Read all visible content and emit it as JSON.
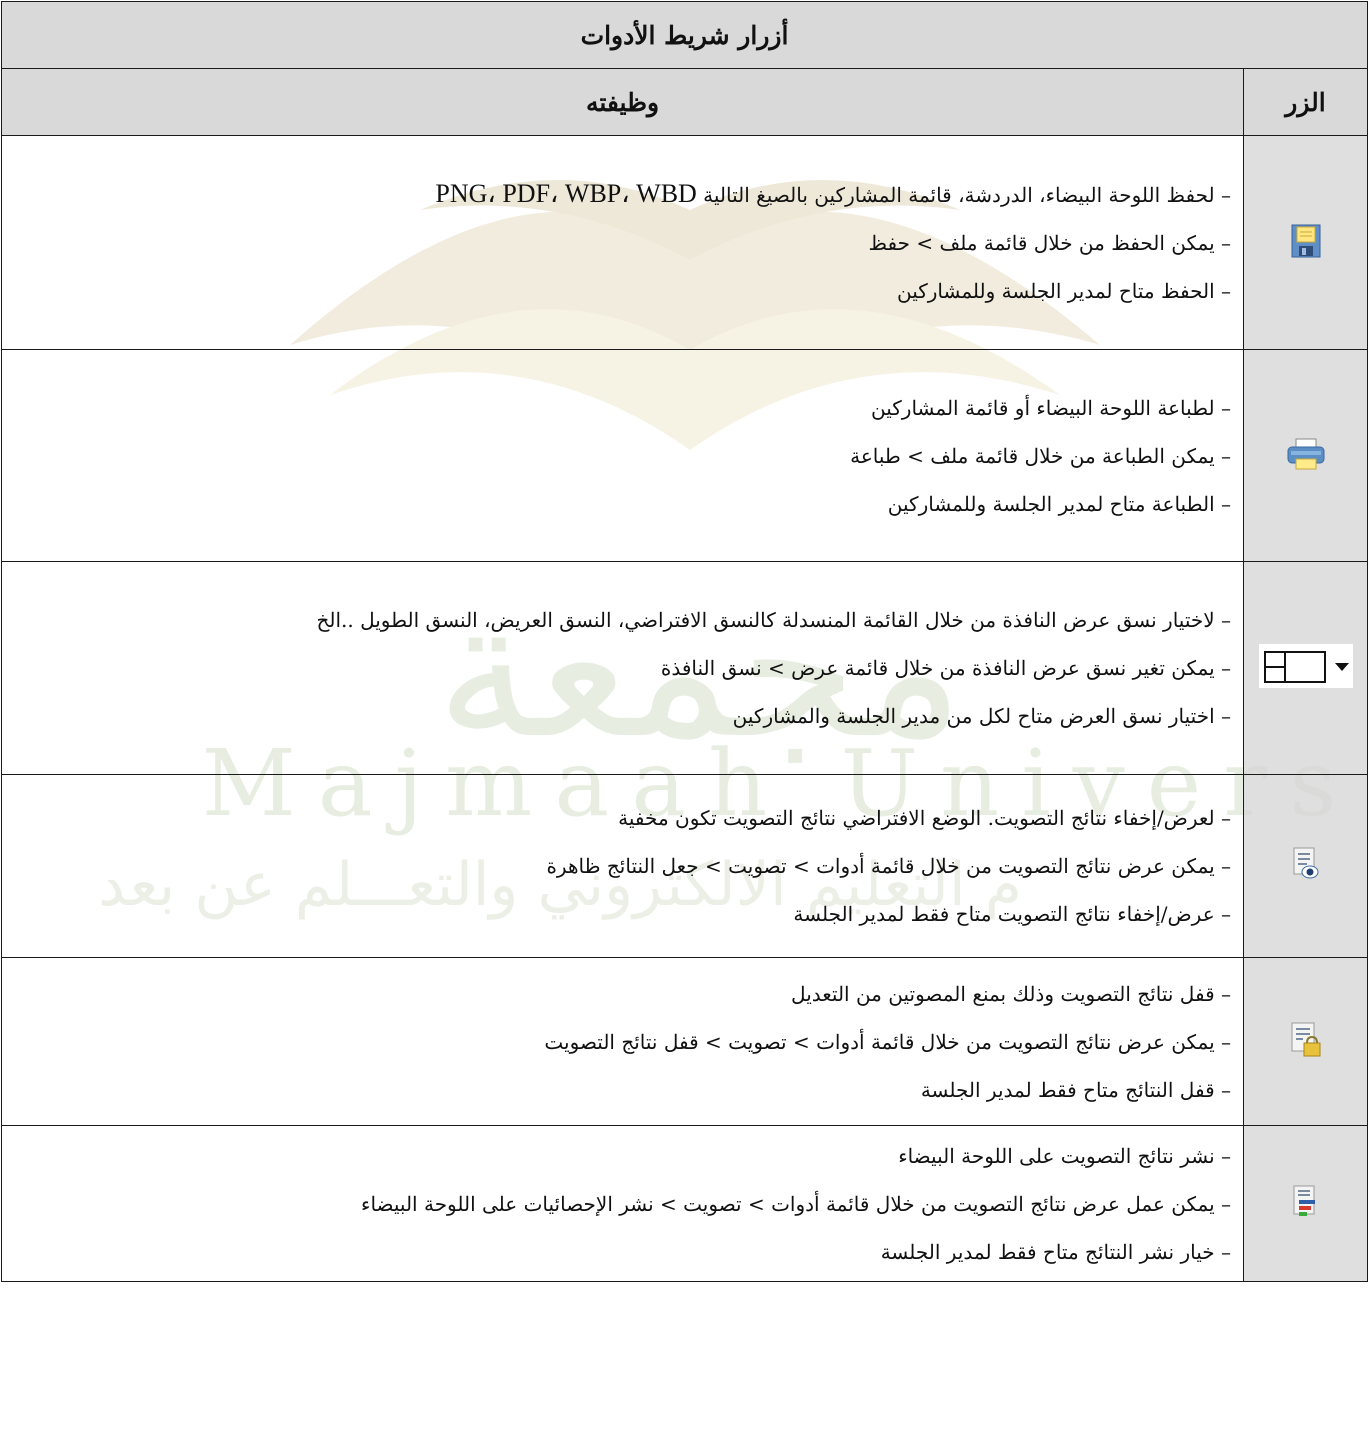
{
  "table": {
    "title": "أزرار شريط الأدوات",
    "col_button": "الزر",
    "col_function": "وظيفته"
  },
  "rows": [
    {
      "icon": "save-icon",
      "lines": [
        "– لحفظ اللوحة البيضاء، الدردشة، قائمة المشاركين بالصيغ التالية",
        "– يمكن الحفظ من خلال قائمة ملف > حفظ",
        "– الحفظ متاح لمدير الجلسة وللمشاركين"
      ],
      "formats": "PNG، PDF، WBP، WBD"
    },
    {
      "icon": "print-icon",
      "lines": [
        "– لطباعة اللوحة البيضاء أو قائمة المشاركين",
        "– يمكن الطباعة من خلال قائمة ملف > طباعة",
        "– الطباعة متاح لمدير الجلسة وللمشاركين"
      ]
    },
    {
      "icon": "window-layout-dropdown-icon",
      "lines": [
        "– لاختيار نسق عرض النافذة من خلال القائمة المنسدلة كالنسق الافتراضي، النسق العريض، النسق الطويل ..الخ",
        "– يمكن تغير نسق عرض النافذة من خلال قائمة عرض > نسق النافذة",
        "– اختيار نسق العرض متاح لكل من مدير الجلسة والمشاركين"
      ]
    },
    {
      "icon": "show-poll-results-icon",
      "lines": [
        "– لعرض/إخفاء نتائج التصويت. الوضع الافتراضي نتائج التصويت تكون مخفية",
        "– يمكن عرض نتائج التصويت من خلال قائمة أدوات > تصويت > جعل النتائج ظاهرة",
        "– عرض/إخفاء نتائج التصويت متاح فقط لمدير الجلسة"
      ]
    },
    {
      "icon": "lock-poll-results-icon",
      "lines": [
        "– قفل نتائج التصويت وذلك بمنع المصوتين من التعديل",
        "– يمكن عرض نتائج التصويت من خلال قائمة أدوات > تصويت > قفل نتائج التصويت",
        "– قفل النتائج متاح فقط لمدير الجلسة"
      ]
    },
    {
      "icon": "publish-poll-results-icon",
      "lines": [
        "– نشر نتائج التصويت على اللوحة البيضاء",
        "– يمكن عمل عرض نتائج التصويت من خلال قائمة أدوات > تصويت > نشر الإحصائيات على اللوحة البيضاء",
        "– خيار نشر النتائج متاح فقط لمدير الجلسة"
      ]
    }
  ],
  "watermark": {
    "latin": "Majmaah Univers",
    "arabic": "ﻣﺠﻤﻌﺔ",
    "subtitle": "م التعليم الالكتروني والتعـــلم عن بعد"
  },
  "colors": {
    "header_bg": "#d6d6d6",
    "border": "#1a1a1a",
    "watermark_gold": "#d9c79a",
    "watermark_green": "#b9c9a6"
  }
}
